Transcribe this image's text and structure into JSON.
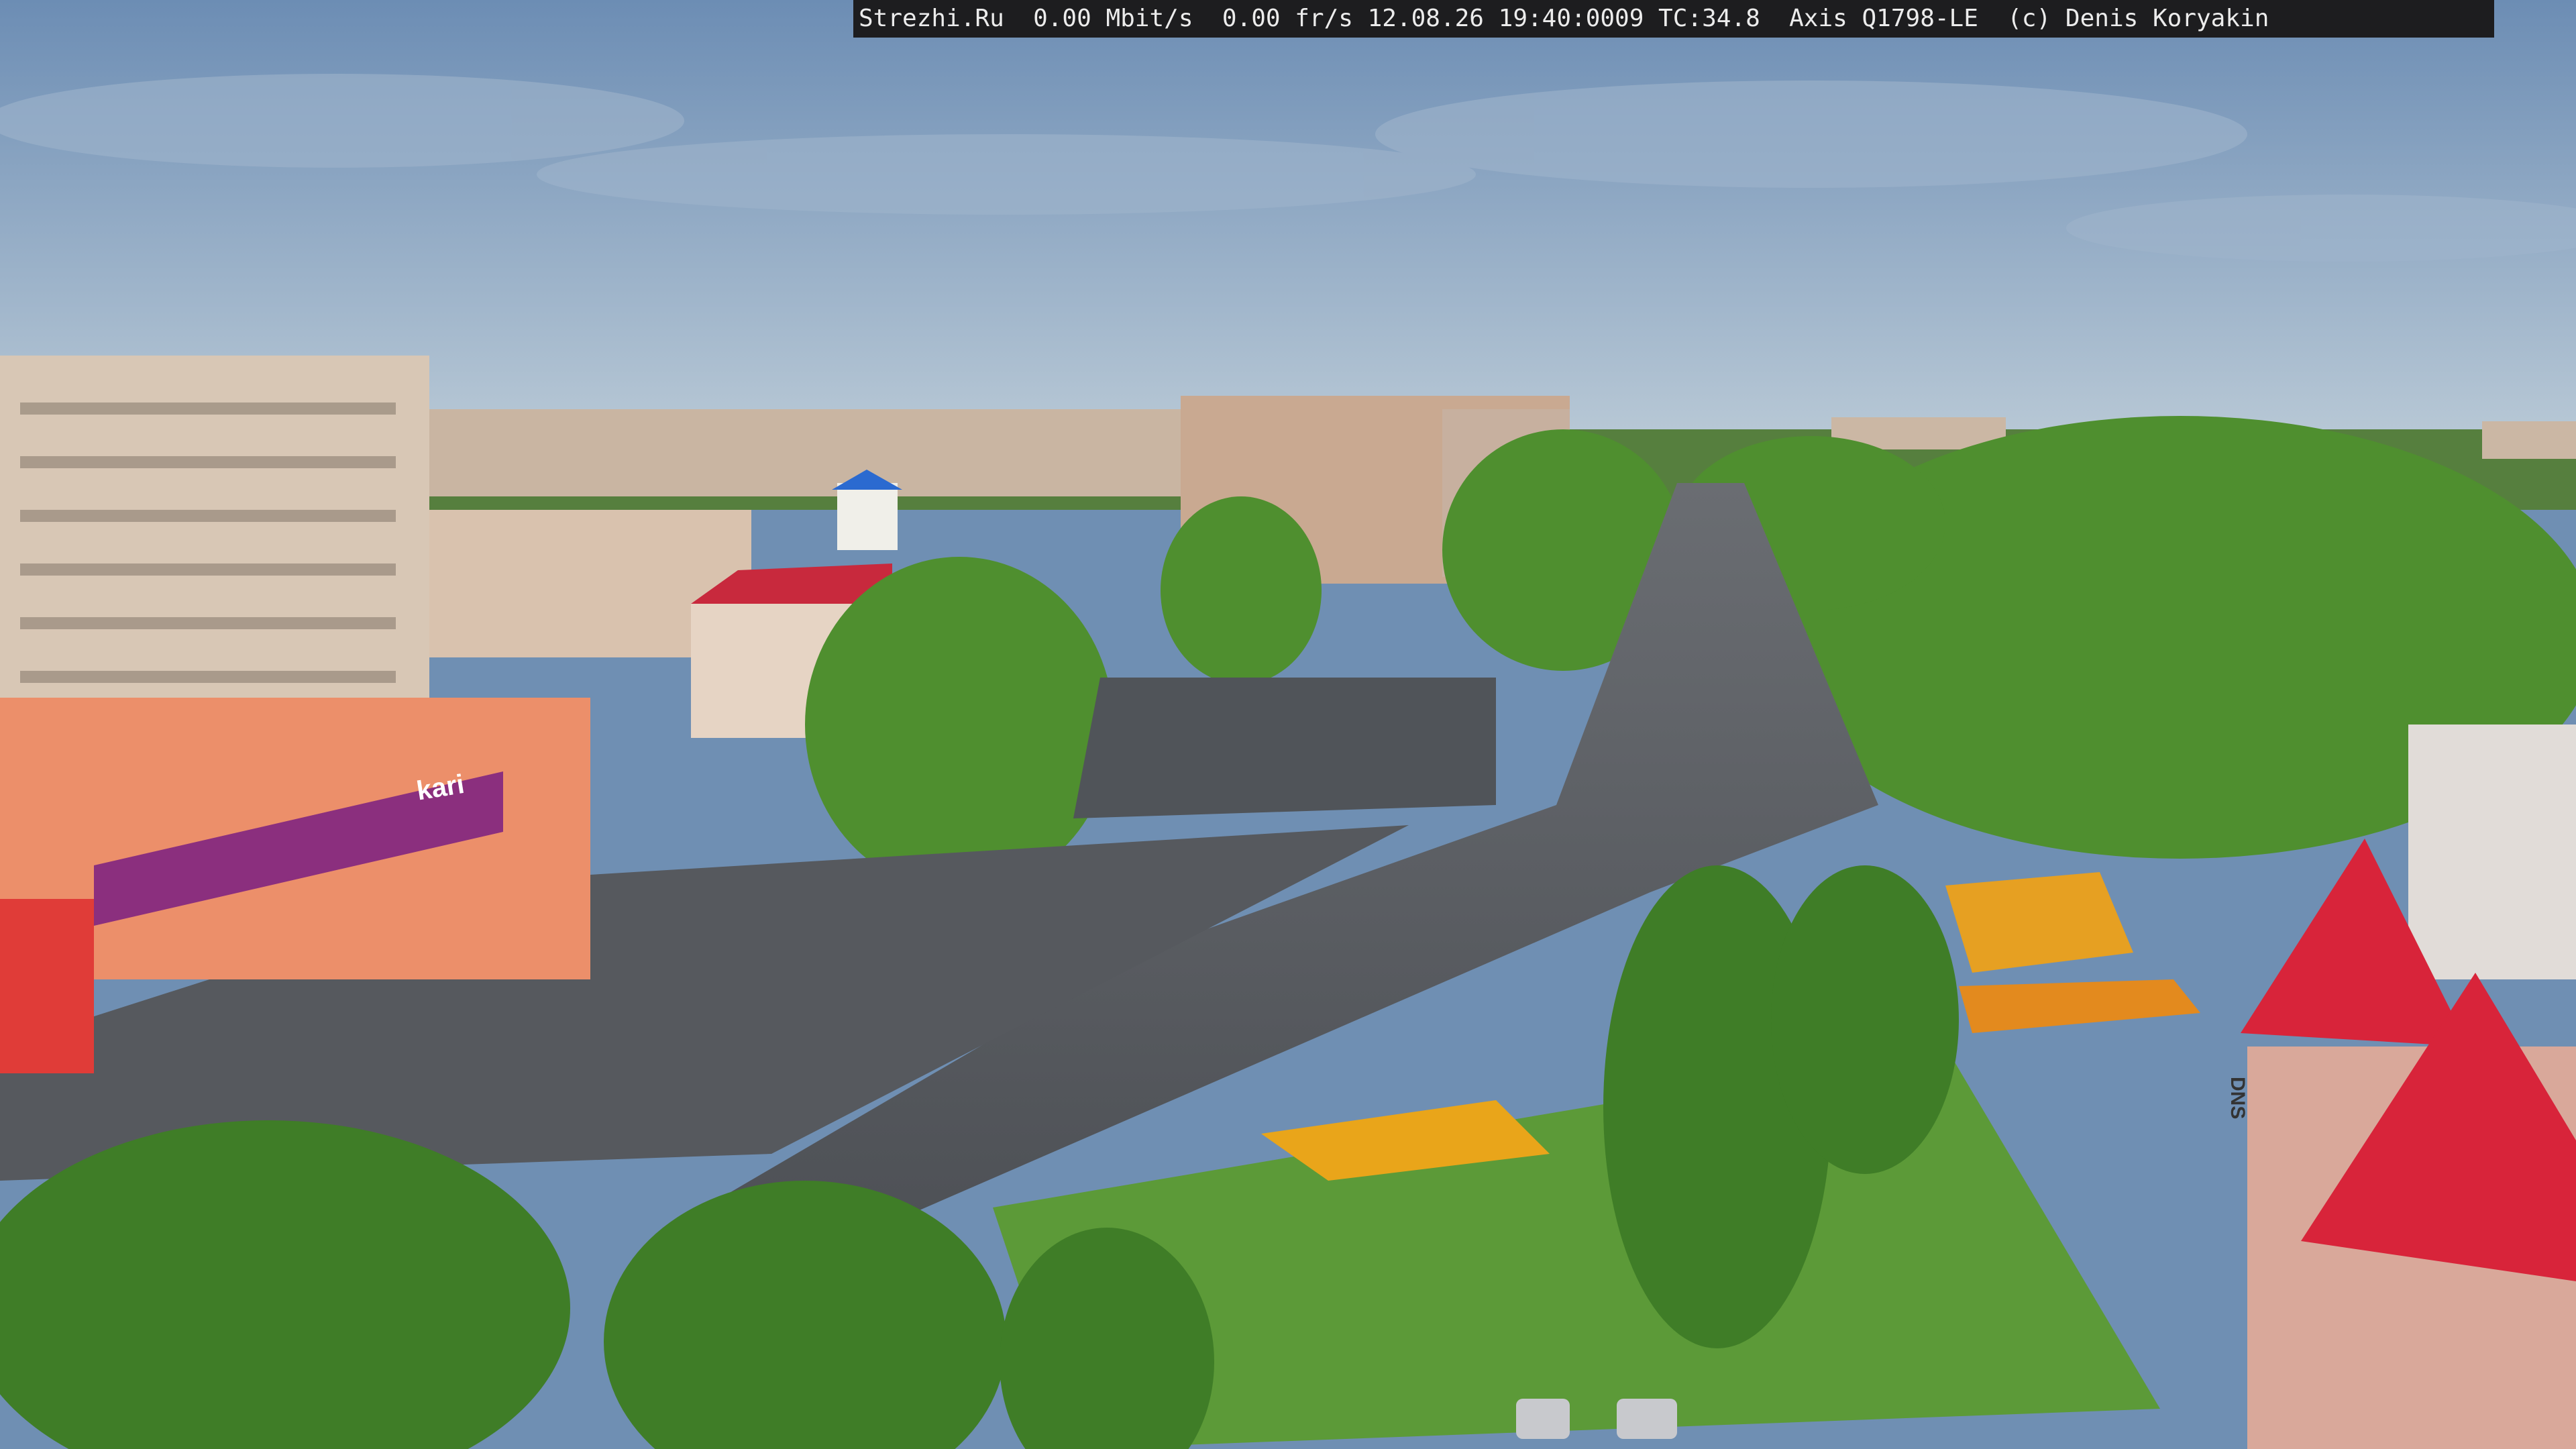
{
  "overlay": {
    "text": "Strezhi.Ru  0.00 Mbit/s  0.00 fr/s 12.08.26 19:40:0009 TC:34.8  Axis Q1798-LE  (c) Denis Koryakin"
  },
  "signs": {
    "store_left": "kari",
    "store_right": "DNS"
  },
  "colors": {
    "sky_top": "#6c8db4",
    "sky_bottom": "#b9c9d6",
    "trees": "#4f8f2f",
    "asphalt": "#5a5d62",
    "red_roof": "#d8243a"
  }
}
